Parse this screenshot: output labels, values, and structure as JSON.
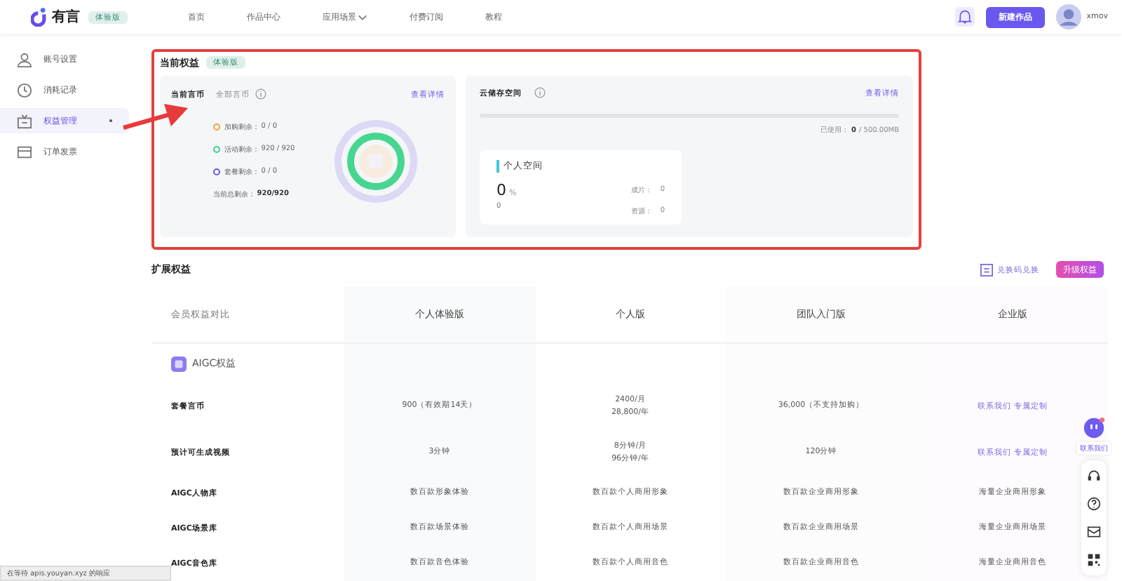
{
  "header": {
    "logo": "有言",
    "edition_badge": "体验版",
    "nav": [
      {
        "label": "首页",
        "selected": false,
        "caret": false
      },
      {
        "label": "作品中心",
        "selected": false,
        "caret": false
      },
      {
        "label": "应用场景",
        "selected": false,
        "caret": true
      },
      {
        "label": "付费订阅",
        "selected": false,
        "caret": false
      },
      {
        "label": "教程",
        "selected": false,
        "caret": false
      }
    ],
    "new_button": "新建作品",
    "username": "xmov"
  },
  "sidebar": {
    "items": [
      {
        "label": "账号设置",
        "selected": false
      },
      {
        "label": "消耗记录",
        "selected": false
      },
      {
        "label": "权益管理",
        "selected": true
      },
      {
        "label": "订单发票",
        "selected": false
      }
    ]
  },
  "current": {
    "title": "当前权益",
    "badge": "体验版",
    "coins": {
      "tabs": [
        {
          "label": "当前言币",
          "selected": true
        },
        {
          "label": "全部言币",
          "selected": false
        }
      ],
      "link": "查看详情",
      "legend": [
        {
          "label": "加购剩余 :",
          "value": "0 / 0",
          "color": "#f0a23a"
        },
        {
          "label": "活动剩余 :",
          "value": "920 / 920",
          "color": "#3ecf8e"
        },
        {
          "label": "套餐剩余 :",
          "value": "0 / 0",
          "color": "#6b5bd6"
        }
      ],
      "total_label": "当前总剩余 :",
      "total_value": "920/920"
    },
    "storage": {
      "title": "云储存空间",
      "link": "查看详情",
      "level": 0,
      "used_label": "已使用：",
      "used_value": "0",
      "used_total": "/ 500.00MB",
      "space": {
        "title": "个人空间",
        "percent": "0",
        "unit": "%",
        "sub": "0",
        "stats": [
          {
            "label": "成片：",
            "value": "0"
          },
          {
            "label": "资源：",
            "value": "0"
          }
        ]
      }
    }
  },
  "extended": {
    "title": "扩展权益",
    "redeem": "兑换码兑换",
    "upgrade": "升级权益",
    "columns": [
      "会员权益对比",
      "个人体验版",
      "个人版",
      "团队入门版",
      "企业版"
    ],
    "rows": [
      {
        "kind": "section",
        "label": "AIGC权益"
      },
      {
        "kind": "data",
        "label": "套餐言币",
        "cells": [
          {
            "lines": [
              "900（有效期14天）"
            ],
            "link": false
          },
          {
            "lines": [
              "2400/月",
              "28,800/年"
            ],
            "link": false
          },
          {
            "lines": [
              "36,000（不支持加购）"
            ],
            "link": false
          },
          {
            "lines": [
              "联系我们 专属定制"
            ],
            "link": true
          }
        ]
      },
      {
        "kind": "data",
        "label": "预计可生成视频",
        "cells": [
          {
            "lines": [
              "3分钟"
            ],
            "link": false
          },
          {
            "lines": [
              "8分钟/月",
              "96分钟/年"
            ],
            "link": false
          },
          {
            "lines": [
              "120分钟"
            ],
            "link": false
          },
          {
            "lines": [
              "联系我们 专属定制"
            ],
            "link": true
          }
        ]
      },
      {
        "kind": "data",
        "label": "AIGC人物库",
        "cells": [
          {
            "lines": [
              "数百款形象体验"
            ],
            "link": false
          },
          {
            "lines": [
              "数百款个人商用形象"
            ],
            "link": false
          },
          {
            "lines": [
              "数百款企业商用形象"
            ],
            "link": false
          },
          {
            "lines": [
              "海量企业商用形象"
            ],
            "link": false
          }
        ]
      },
      {
        "kind": "data",
        "label": "AIGC场景库",
        "cells": [
          {
            "lines": [
              "数百款场景体验"
            ],
            "link": false
          },
          {
            "lines": [
              "数百款个人商用场景"
            ],
            "link": false
          },
          {
            "lines": [
              "数百款企业商用场景"
            ],
            "link": false
          },
          {
            "lines": [
              "海量企业商用场景"
            ],
            "link": false
          }
        ]
      },
      {
        "kind": "data",
        "label": "AIGC音色库",
        "cells": [
          {
            "lines": [
              "数百款音色体验"
            ],
            "link": false
          },
          {
            "lines": [
              "数百款个人商用音色"
            ],
            "link": false
          },
          {
            "lines": [
              "数百款企业商用音色"
            ],
            "link": false
          },
          {
            "lines": [
              "海量企业商用音色"
            ],
            "link": false
          }
        ]
      }
    ]
  },
  "float_panel": {
    "contact": "联系我们",
    "unread": true
  },
  "status_bar": "在等待 apis.youyan.xyz 的响应"
}
